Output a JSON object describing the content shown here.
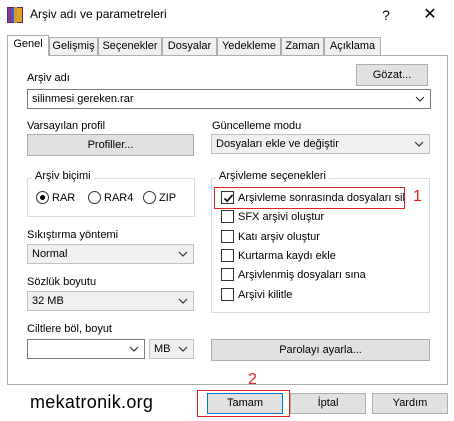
{
  "window": {
    "title": "Arşiv adı ve parametreleri",
    "help_glyph": "?",
    "close_glyph": "✕"
  },
  "tabs": [
    "Genel",
    "Gelişmiş",
    "Seçenekler",
    "Dosyalar",
    "Yedekleme",
    "Zaman",
    "Açıklama"
  ],
  "general": {
    "archive_name_label": "Arşiv adı",
    "browse_button": "Gözat...",
    "archive_name_value": "silinmesi gereken.rar",
    "default_profile_label": "Varsayılan profil",
    "profiles_button": "Profiller...",
    "update_mode_label": "Güncelleme modu",
    "update_mode_value": "Dosyaları ekle ve değiştir",
    "archive_format": {
      "title": "Arşiv biçimi",
      "options": [
        "RAR",
        "RAR4",
        "ZIP"
      ],
      "selected": "RAR"
    },
    "compression_method_label": "Sıkıştırma yöntemi",
    "compression_method_value": "Normal",
    "dictionary_size_label": "Sözlük boyutu",
    "dictionary_size_value": "32 MB",
    "split_label": "Ciltlere böl, boyut",
    "split_value": "",
    "split_unit": "MB",
    "archiving_options": {
      "title": "Arşivleme seçenekleri",
      "items": [
        {
          "label": "Arşivleme sonrasında dosyaları sil",
          "checked": true
        },
        {
          "label": "SFX arşivi oluştur",
          "checked": false
        },
        {
          "label": "Katı arşiv oluştur",
          "checked": false
        },
        {
          "label": "Kurtarma kaydı ekle",
          "checked": false
        },
        {
          "label": "Arşivlenmiş dosyaları sına",
          "checked": false
        },
        {
          "label": "Arşivi kilitle",
          "checked": false
        }
      ]
    },
    "set_password_button": "Parolayı ayarla..."
  },
  "footer": {
    "watermark": "mekatronik.org",
    "ok_button": "Tamam",
    "cancel_button": "İptal",
    "help_button": "Yardım"
  },
  "annotations": {
    "marker_1": "1",
    "marker_2": "2",
    "color": "#d22222"
  }
}
